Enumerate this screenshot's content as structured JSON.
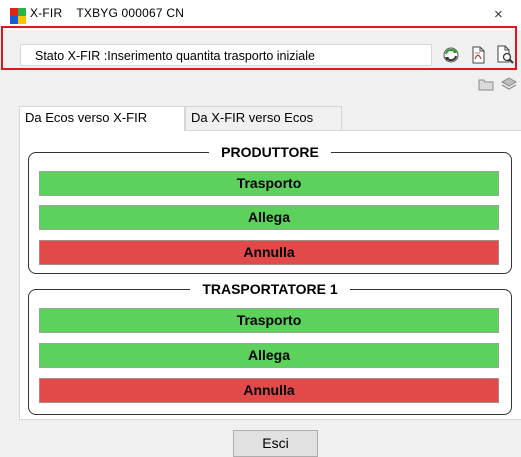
{
  "window": {
    "app_name": "X-FIR",
    "doc_code": "TXBYG 000067 CN",
    "close_glyph": "×"
  },
  "status": {
    "label": "Stato X-FIR :Inserimento quantita trasporto iniziale"
  },
  "toolbar": {
    "icons": [
      "refresh-icon",
      "pdf-document-icon",
      "search-document-icon",
      "folder-icon",
      "layers-icon"
    ]
  },
  "tabs": [
    {
      "label": "Da Ecos verso X-FIR",
      "active": true
    },
    {
      "label": "Da X-FIR verso Ecos",
      "active": false
    }
  ],
  "groups": [
    {
      "title": "PRODUTTORE",
      "buttons": [
        {
          "label": "Trasporto",
          "color": "#5cd15c"
        },
        {
          "label": "Allega",
          "color": "#5cd15c"
        },
        {
          "label": "Annulla",
          "color": "#e24a4a"
        }
      ]
    },
    {
      "title": "TRASPORTATORE 1",
      "buttons": [
        {
          "label": "Trasporto",
          "color": "#5cd15c"
        },
        {
          "label": "Allega",
          "color": "#5cd15c"
        },
        {
          "label": "Annulla",
          "color": "#e24a4a"
        }
      ]
    }
  ],
  "footer": {
    "exit_label": "Esci"
  },
  "colors": {
    "highlight": "#e1141f",
    "green": "#5cd15c",
    "red": "#e24a4a"
  }
}
